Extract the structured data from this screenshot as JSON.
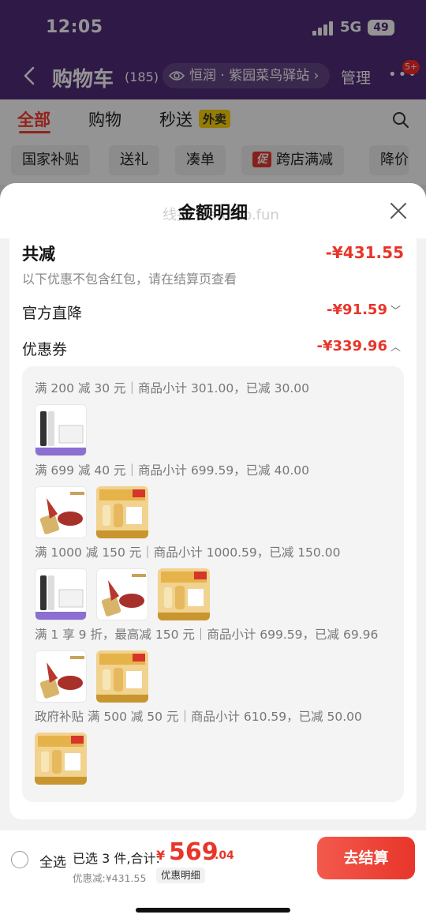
{
  "status_bar": {
    "time": "12:05",
    "network": "5G",
    "battery": "49"
  },
  "header": {
    "title": "购物车",
    "count": "(185)",
    "station": "恒润 · 紫园菜鸟驿站",
    "manage": "管理",
    "badge": "5+"
  },
  "tabs": [
    {
      "label": "全部"
    },
    {
      "label": "购物"
    },
    {
      "label": "秒送"
    }
  ],
  "tab_tag": "外卖",
  "chips": [
    {
      "label": "国家补贴"
    },
    {
      "label": "送礼"
    },
    {
      "label": "凑单"
    },
    {
      "tag": "促",
      "label": "跨店满减"
    },
    {
      "label": "降价"
    }
  ],
  "sheet": {
    "title": "金额明细",
    "watermark": "线报 xianbao.fun",
    "total_label": "共减",
    "total_amount": "-¥431.55",
    "note": "以下优惠不包含红包，请在结算页查看",
    "official_label": "官方直降",
    "official_amount": "-¥91.59",
    "coupon_label": "优惠券",
    "coupon_amount": "-¥339.96",
    "rules": [
      {
        "text": "满 200 减 30 元｜商品小计 301.00，已减 30.00",
        "thumbs": [
          "serum-set"
        ]
      },
      {
        "text": "满 699 减 40 元｜商品小计 699.59，已减 40.00",
        "thumbs": [
          "lipstick",
          "gift-box"
        ]
      },
      {
        "text": "满 1000 减 150 元｜商品小计 1000.59，已减 150.00",
        "thumbs": [
          "serum-set",
          "lipstick",
          "gift-box"
        ]
      },
      {
        "text": "满 1 享 9 折，最高减 150 元｜商品小计 699.59，已减 69.96",
        "thumbs": [
          "lipstick",
          "gift-box"
        ]
      },
      {
        "text": "政府补贴 满 500 减 50 元｜商品小计 610.59，已减 50.00",
        "thumbs": [
          "gift-box"
        ]
      }
    ]
  },
  "bottom": {
    "select_all": "全选",
    "selected_prefix": "已选 3 件,合计:",
    "currency": "¥",
    "price_int": "569",
    "price_dec": ".04",
    "discount": "优惠减:¥431.55",
    "detail": "优惠明细",
    "checkout": "去结算"
  }
}
